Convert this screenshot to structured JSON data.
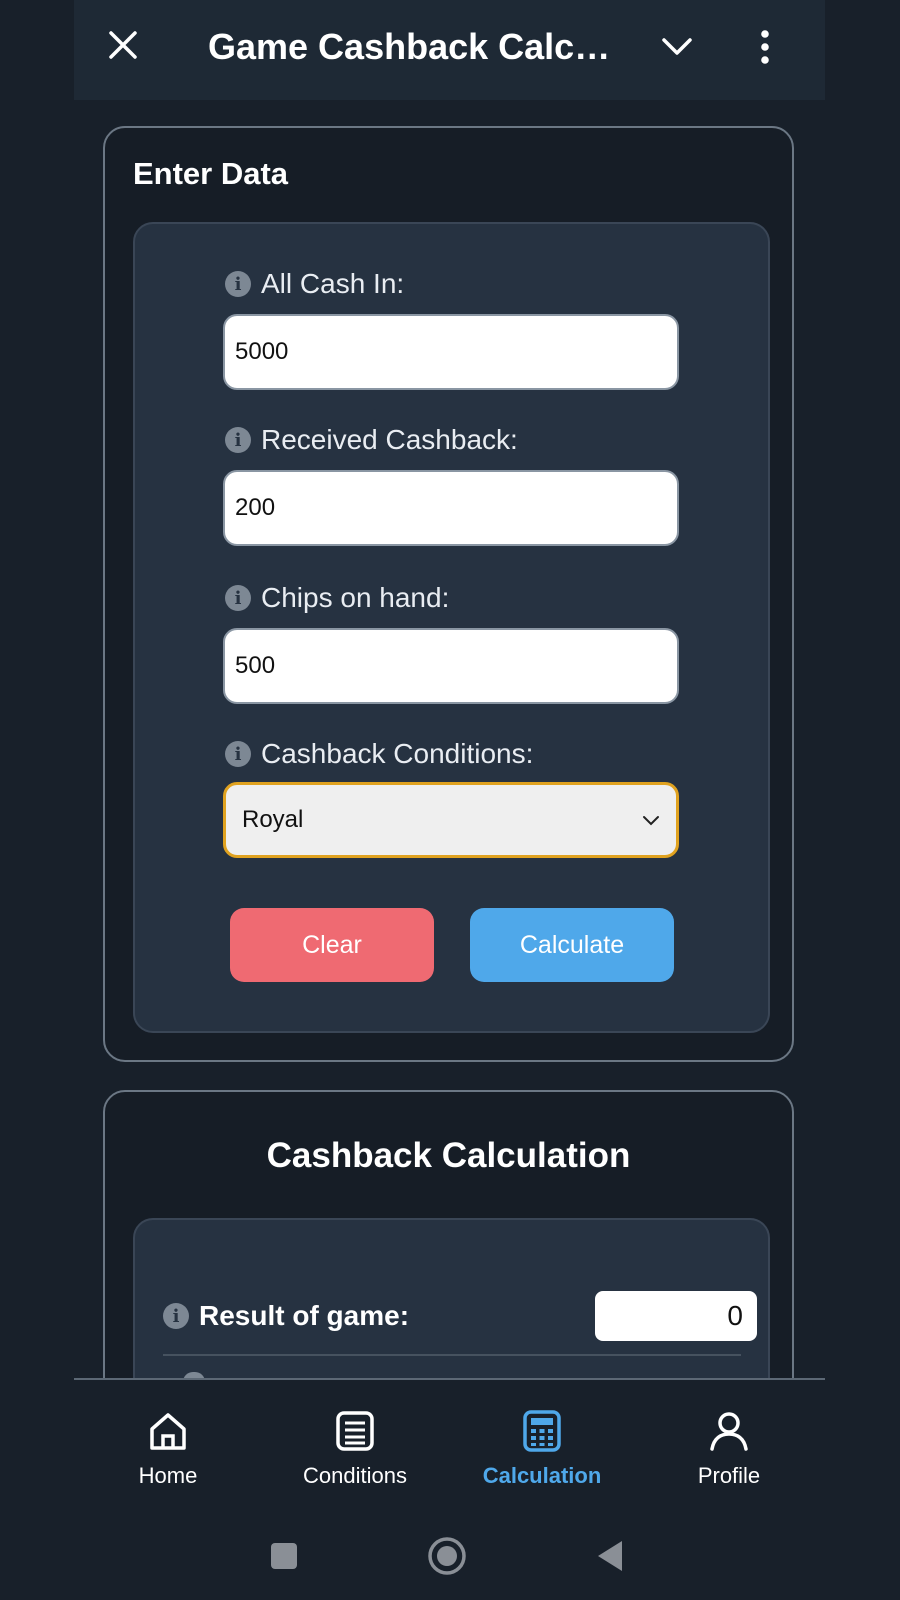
{
  "topbar": {
    "title": "Game Cashback Calcul...",
    "close_icon": "close-icon",
    "chevron_icon": "chevron-down-icon",
    "more_icon": "more-vertical-icon"
  },
  "input_card": {
    "heading": "Enter Data",
    "fields": [
      {
        "label": "All Cash In:",
        "value": "5000"
      },
      {
        "label": "Received Cashback:",
        "value": "200"
      },
      {
        "label": "Chips on hand:",
        "value": "500"
      }
    ],
    "conditions": {
      "label": "Cashback Conditions:",
      "selected": "Royal"
    },
    "clear_label": "Clear",
    "calculate_label": "Calculate"
  },
  "result_card": {
    "heading": "Cashback Calculation",
    "rows": [
      {
        "label": "Result of game:",
        "value": "0"
      }
    ]
  },
  "bottom_nav": {
    "items": [
      {
        "label": "Home",
        "icon": "home-icon"
      },
      {
        "label": "Conditions",
        "icon": "list-icon"
      },
      {
        "label": "Calculation",
        "icon": "calculator-icon",
        "active": true
      },
      {
        "label": "Profile",
        "icon": "profile-icon"
      }
    ]
  },
  "colors": {
    "accent": "#4fa8ea",
    "danger": "#ef6a72",
    "focus": "#e0a21f",
    "background": "#18202a",
    "panel": "#263241"
  }
}
